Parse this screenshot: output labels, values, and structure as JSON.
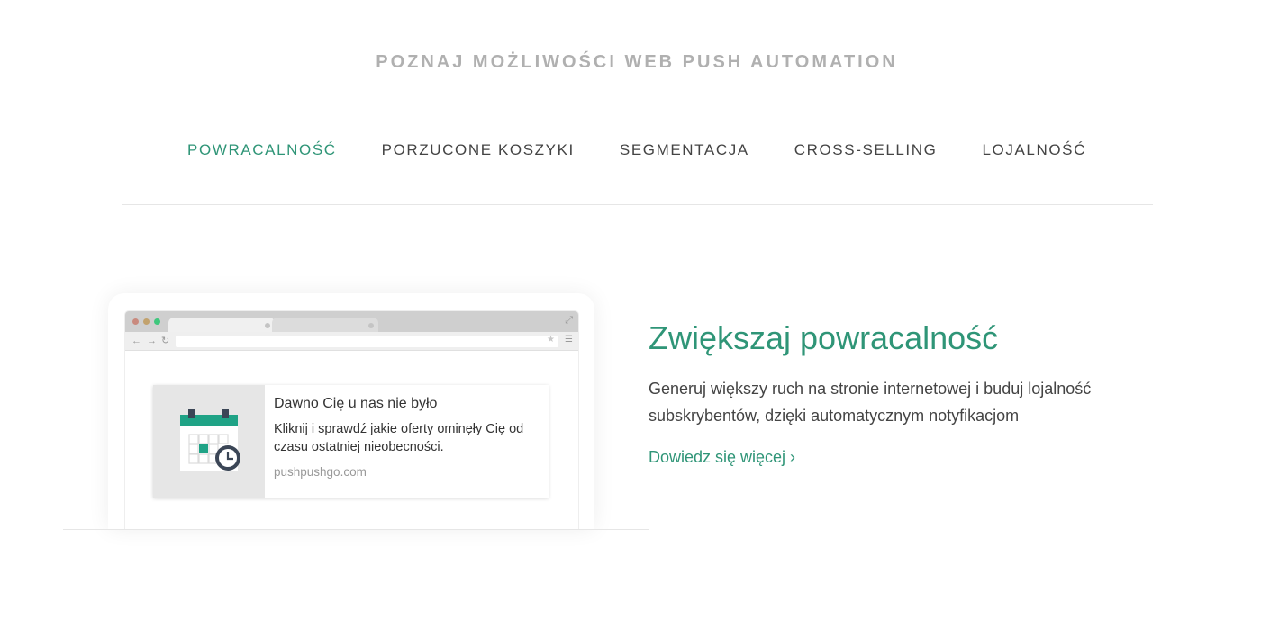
{
  "section": {
    "title": "POZNAJ MOŻLIWOŚCI WEB PUSH AUTOMATION"
  },
  "tabs": [
    {
      "label": "POWRACALNOŚĆ",
      "active": true
    },
    {
      "label": "PORZUCONE KOSZYKI",
      "active": false
    },
    {
      "label": "SEGMENTACJA",
      "active": false
    },
    {
      "label": "CROSS-SELLING",
      "active": false
    },
    {
      "label": "LOJALNOŚĆ",
      "active": false
    }
  ],
  "illustration": {
    "notification": {
      "title": "Dawno Cię u nas nie było",
      "text": "Kliknij i sprawdź jakie oferty ominęły Cię od czasu ostatniej nieobecności.",
      "domain": "pushpushgo.com",
      "icon": "calendar-clock-icon"
    }
  },
  "content": {
    "heading": "Zwiększaj powracalność",
    "description": "Generuj większy ruch na stronie internetowej i buduj lojalność subskrybentów, dzięki automatycznym notyfikacjom",
    "link": "Dowiedz się więcej ›"
  },
  "colors": {
    "accent": "#2f9577",
    "title_gray": "#b0b0b0",
    "text": "#444444",
    "calendar_teal": "#1fa386",
    "calendar_dark": "#3b4656"
  }
}
